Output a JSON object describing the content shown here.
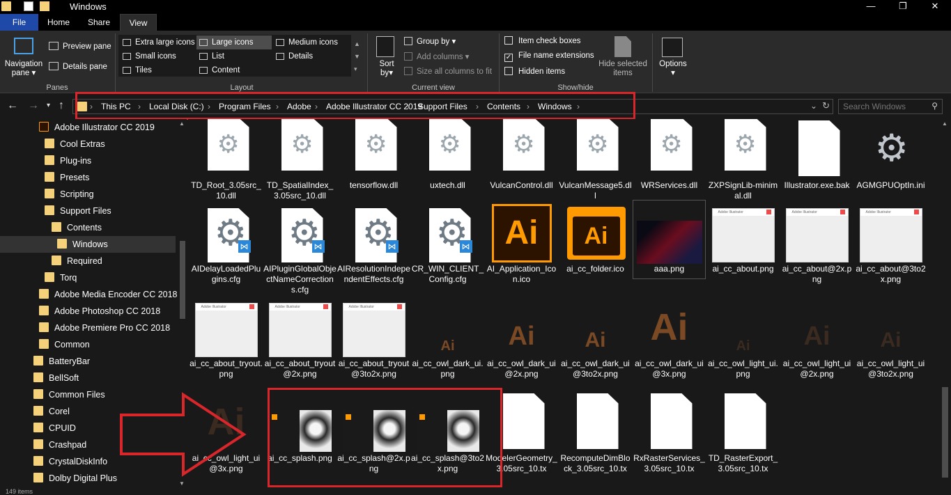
{
  "window": {
    "title": "Windows",
    "min": "—",
    "max": "❐",
    "close": "✕"
  },
  "tabs": [
    "File",
    "Home",
    "Share",
    "View"
  ],
  "ribbon": {
    "panes": {
      "nav_pane": "Navigation pane",
      "preview": "Preview pane",
      "details": "Details pane",
      "label": "Panes"
    },
    "layout": {
      "items": [
        "Extra large icons",
        "Large icons",
        "Medium icons",
        "Small icons",
        "List",
        "Details",
        "Tiles",
        "Content"
      ],
      "selected": "Large icons",
      "label": "Layout"
    },
    "current_view": {
      "sort": "Sort by",
      "group": "Group by",
      "add_cols": "Add columns",
      "size_cols": "Size all columns to fit",
      "label": "Current view"
    },
    "show_hide": {
      "item_checkboxes": "Item check boxes",
      "extensions": "File name extensions",
      "hidden": "Hidden items",
      "hide_selected": "Hide selected items",
      "label": "Show/hide",
      "extensions_checked": true
    },
    "options": "Options"
  },
  "address": {
    "crumbs": [
      "This PC",
      "Local Disk (C:)",
      "Program Files",
      "Adobe",
      "Adobe Illustrator CC 2019",
      "Support Files",
      "Contents",
      "Windows"
    ],
    "search_placeholder": "Search Windows"
  },
  "nav_tree": [
    {
      "label": "Adobe Illustrator CC 2019",
      "indent": 1,
      "icon": "ai"
    },
    {
      "label": "Cool Extras",
      "indent": 2
    },
    {
      "label": "Plug-ins",
      "indent": 2
    },
    {
      "label": "Presets",
      "indent": 2
    },
    {
      "label": "Scripting",
      "indent": 2
    },
    {
      "label": "Support Files",
      "indent": 2
    },
    {
      "label": "Contents",
      "indent": 3
    },
    {
      "label": "Windows",
      "indent": 4,
      "selected": true
    },
    {
      "label": "Required",
      "indent": 3
    },
    {
      "label": "Torq",
      "indent": 2
    },
    {
      "label": "Adobe Media Encoder CC 2018",
      "indent": 1
    },
    {
      "label": "Adobe Photoshop CC 2018",
      "indent": 1
    },
    {
      "label": "Adobe Premiere Pro CC 2018",
      "indent": 1
    },
    {
      "label": "Common",
      "indent": 1
    },
    {
      "label": "BatteryBar",
      "indent": 0
    },
    {
      "label": "BellSoft",
      "indent": 0
    },
    {
      "label": "Common Files",
      "indent": 0
    },
    {
      "label": "Corel",
      "indent": 0
    },
    {
      "label": "CPUID",
      "indent": 0
    },
    {
      "label": "Crashpad",
      "indent": 0
    },
    {
      "label": "CrystalDiskInfo",
      "indent": 0
    },
    {
      "label": "Dolby Digital Plus",
      "indent": 0
    }
  ],
  "files": [
    {
      "name": "TD_Root_3.05src_10.dll",
      "type": "dll"
    },
    {
      "name": "TD_SpatialIndex_3.05src_10.dll",
      "type": "dll"
    },
    {
      "name": "tensorflow.dll",
      "type": "dll"
    },
    {
      "name": "uxtech.dll",
      "type": "dll"
    },
    {
      "name": "VulcanControl.dll",
      "type": "dll"
    },
    {
      "name": "VulcanMessage5.dll",
      "type": "dll"
    },
    {
      "name": "WRServices.dll",
      "type": "dll"
    },
    {
      "name": "ZXPSignLib-minimal.dll",
      "type": "dll"
    },
    {
      "name": "Illustrator.exe.bak",
      "type": "blank"
    },
    {
      "name": "AGMGPUOptIn.ini",
      "type": "ini"
    },
    {
      "name": "AIDelayLoadedPlugins.cfg",
      "type": "cfg"
    },
    {
      "name": "AIPluginGlobalObjectNameCorrections.cfg",
      "type": "cfg"
    },
    {
      "name": "AIResolutionIndependentEffects.cfg",
      "type": "cfg"
    },
    {
      "name": "CR_WIN_CLIENT_Config.cfg",
      "type": "cfg"
    },
    {
      "name": "AI_Application_Icon.ico",
      "type": "aiico",
      "glyph": "Ai"
    },
    {
      "name": "ai_cc_folder.ico",
      "type": "aifolder",
      "glyph": "Ai"
    },
    {
      "name": "aaa.png",
      "type": "aaa"
    },
    {
      "name": "ai_cc_about.png",
      "type": "shot",
      "header": "Adobe Illustrator"
    },
    {
      "name": "ai_cc_about@2x.png",
      "type": "shot",
      "header": "Adobe Illustrator"
    },
    {
      "name": "ai_cc_about@3to2x.png",
      "type": "shot",
      "header": "Adobe Illustrator"
    },
    {
      "name": "ai_cc_about_tryout.png",
      "type": "shot",
      "header": "Adobe Illustrator"
    },
    {
      "name": "ai_cc_about_tryout@2x.png",
      "type": "shot",
      "header": "Adobe Illustrator"
    },
    {
      "name": "ai_cc_about_tryout@3to2x.png",
      "type": "shot",
      "header": "Adobe Illustrator"
    },
    {
      "name": "ai_cc_owl_dark_ui.png",
      "type": "ghost",
      "glyph": "Ai",
      "size": 20
    },
    {
      "name": "ai_cc_owl_dark_ui@2x.png",
      "type": "ghost",
      "glyph": "Ai",
      "size": 38
    },
    {
      "name": "ai_cc_owl_dark_ui@3to2x.png",
      "type": "ghost",
      "glyph": "Ai",
      "size": 30
    },
    {
      "name": "ai_cc_owl_dark_ui@3x.png",
      "type": "ghost",
      "glyph": "Ai",
      "size": 54
    },
    {
      "name": "ai_cc_owl_light_ui.png",
      "type": "ghost",
      "glyph": "Ai",
      "size": 20,
      "dim": true
    },
    {
      "name": "ai_cc_owl_light_ui@2x.png",
      "type": "ghost",
      "glyph": "Ai",
      "size": 38,
      "dim": true
    },
    {
      "name": "ai_cc_owl_light_ui@3to2x.png",
      "type": "ghost",
      "glyph": "Ai",
      "size": 30,
      "dim": true
    },
    {
      "name": "ai_cc_owl_light_ui@3x.png",
      "type": "ghost",
      "glyph": "Ai",
      "size": 54,
      "dim": true
    },
    {
      "name": "ai_cc_splash.png",
      "type": "splash"
    },
    {
      "name": "ai_cc_splash@2x.png",
      "type": "splash"
    },
    {
      "name": "ai_cc_splash@3to2x.png",
      "type": "splash"
    },
    {
      "name": "ModelerGeometry_3.05src_10.tx",
      "type": "blank"
    },
    {
      "name": "RecomputeDimBlock_3.05src_10.tx",
      "type": "blank"
    },
    {
      "name": "RxRasterServices_3.05src_10.tx",
      "type": "blank"
    },
    {
      "name": "TD_RasterExport_3.05src_10.tx",
      "type": "blank"
    }
  ],
  "colors": {
    "highlight": "#d9262b",
    "ai_orange": "#ff9a00",
    "file_tab": "#1f49a8"
  },
  "status": "149 items"
}
